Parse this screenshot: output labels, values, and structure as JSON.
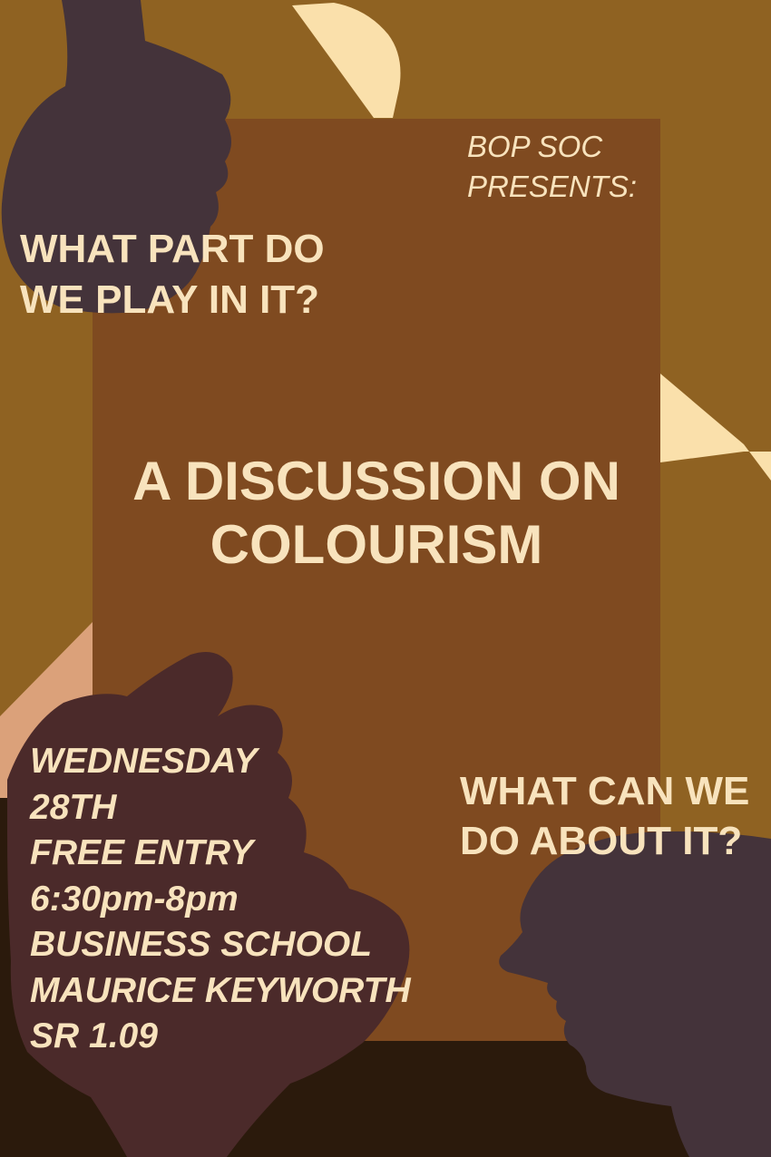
{
  "presenter": {
    "line1": "BOP SOC",
    "line2": "PRESENTS:"
  },
  "question_top": {
    "line1": "WHAT PART DO",
    "line2": "WE PLAY IN IT?"
  },
  "title": {
    "line1": "A DISCUSSION ON",
    "line2": "COLOURISM"
  },
  "question_bottom": {
    "line1": "WHAT CAN WE",
    "line2": "DO ABOUT IT?"
  },
  "event_details": {
    "day": "WEDNESDAY",
    "date": "28TH",
    "entry": "FREE ENTRY",
    "time": "6:30pm-8pm",
    "building": "BUSINESS SCHOOL",
    "room_name": "MAURICE KEYWORTH",
    "room": "SR 1.09"
  },
  "colors": {
    "background": "#8f6222",
    "panel": "#7f4a20",
    "cream_text": "#f8e3bd",
    "accent_light": "#fae0ab",
    "dark_floor": "#2b1a0c",
    "silhouette": "#44333a",
    "hand_dark": "#4b2a2a",
    "skin_light": "#dba17a"
  }
}
